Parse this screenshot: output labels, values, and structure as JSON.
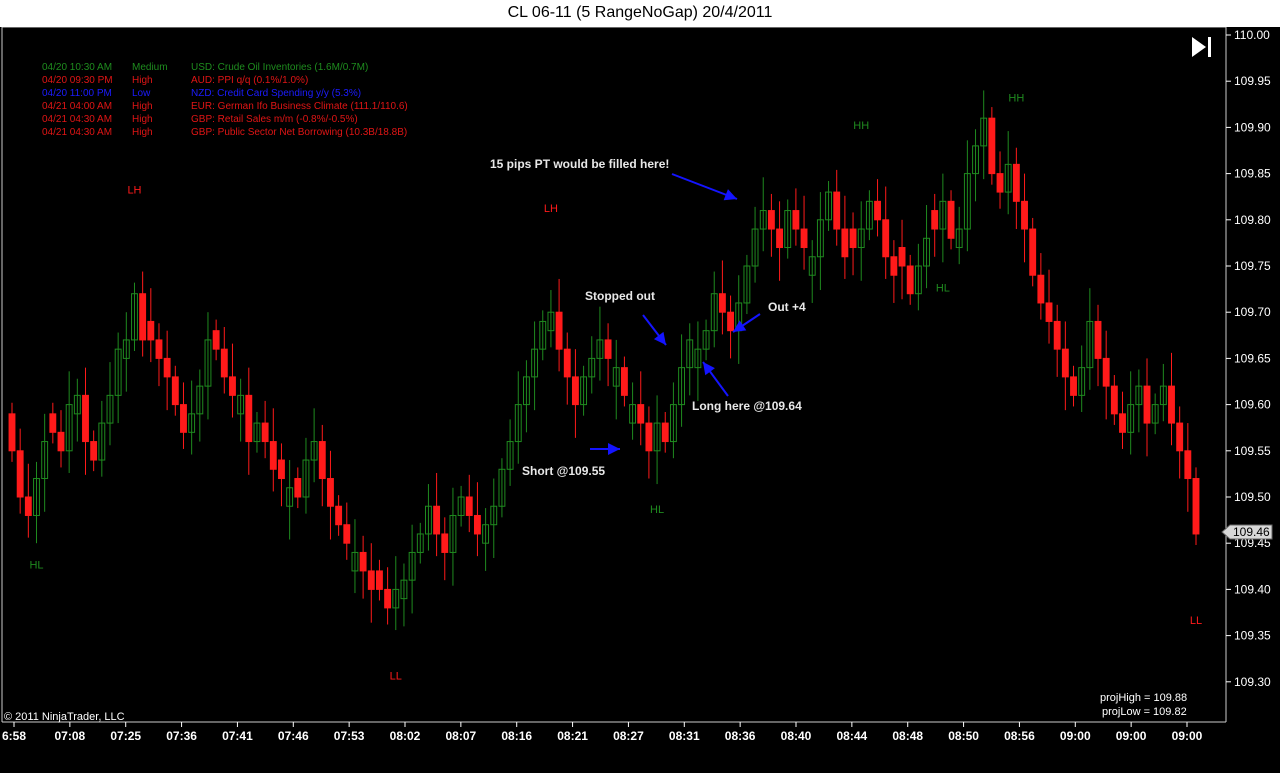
{
  "window": {
    "title": "CL 06-11 (5 RangeNoGap)  20/4/2011"
  },
  "toolbar": {
    "play_icon": "skip-to-end-icon"
  },
  "news": [
    {
      "time": "04/20 10:30 AM",
      "impact": "Medium",
      "event": "USD: Crude Oil Inventories (1.6M/0.7M)",
      "color": "#1e8c1e"
    },
    {
      "time": "04/20 09:30 PM",
      "impact": "High",
      "event": "AUD: PPI q/q (0.1%/1.0%)",
      "color": "#e01515"
    },
    {
      "time": "04/20 11:00 PM",
      "impact": "Low",
      "event": "NZD: Credit Card Spending y/y (5.3%)",
      "color": "#1c1cff"
    },
    {
      "time": "04/21 04:00 AM",
      "impact": "High",
      "event": "EUR: German Ifo Business Climate (111.1/110.6)",
      "color": "#e01515"
    },
    {
      "time": "04/21 04:30 AM",
      "impact": "High",
      "event": "GBP: Retail Sales m/m (-0.8%/-0.5%)",
      "color": "#e01515"
    },
    {
      "time": "04/21 04:30 AM",
      "impact": "High",
      "event": "GBP: Public Sector Net Borrowing (10.3B/18.8B)",
      "color": "#e01515"
    }
  ],
  "chart_data": {
    "type": "candlestick",
    "ylim": [
      109.25,
      110.02
    ],
    "y_ticks": [
      "110.00",
      "109.95",
      "109.90",
      "109.85",
      "109.80",
      "109.75",
      "109.70",
      "109.65",
      "109.60",
      "109.55",
      "109.50",
      "109.45",
      "109.40",
      "109.35",
      "109.30"
    ],
    "x_ticks": [
      "6:58",
      "07:08",
      "07:25",
      "07:36",
      "07:41",
      "07:46",
      "07:53",
      "08:02",
      "08:07",
      "08:16",
      "08:21",
      "08:27",
      "08:31",
      "08:36",
      "08:40",
      "08:44",
      "08:48",
      "08:50",
      "08:56",
      "09:00",
      "09:00",
      "09:00"
    ],
    "bar_closes": [
      109.55,
      109.5,
      109.48,
      109.52,
      109.56,
      109.57,
      109.55,
      109.6,
      109.61,
      109.56,
      109.54,
      109.58,
      109.61,
      109.66,
      109.67,
      109.72,
      109.67,
      109.67,
      109.65,
      109.63,
      109.6,
      109.57,
      109.59,
      109.62,
      109.67,
      109.66,
      109.63,
      109.61,
      109.61,
      109.56,
      109.58,
      109.56,
      109.53,
      109.52,
      109.51,
      109.5,
      109.54,
      109.56,
      109.52,
      109.49,
      109.47,
      109.45,
      109.44,
      109.42,
      109.4,
      109.4,
      109.38,
      109.4,
      109.41,
      109.44,
      109.46,
      109.49,
      109.46,
      109.44,
      109.48,
      109.5,
      109.48,
      109.46,
      109.47,
      109.49,
      109.53,
      109.56,
      109.6,
      109.63,
      109.66,
      109.69,
      109.7,
      109.66,
      109.63,
      109.6,
      109.63,
      109.65,
      109.67,
      109.65,
      109.64,
      109.61,
      109.6,
      109.58,
      109.55,
      109.58,
      109.56,
      109.6,
      109.64,
      109.67,
      109.66,
      109.68,
      109.72,
      109.7,
      109.68,
      109.71,
      109.75,
      109.79,
      109.81,
      109.79,
      109.77,
      109.81,
      109.79,
      109.77,
      109.76,
      109.8,
      109.83,
      109.79,
      109.76,
      109.77,
      109.79,
      109.82,
      109.8,
      109.76,
      109.74,
      109.75,
      109.72,
      109.75,
      109.78,
      109.79,
      109.82,
      109.78,
      109.79,
      109.85,
      109.88,
      109.91,
      109.85,
      109.83,
      109.86,
      109.82,
      109.79,
      109.74,
      109.71,
      109.69,
      109.66,
      109.63,
      109.61,
      109.64,
      109.69,
      109.65,
      109.62,
      109.59,
      109.57,
      109.6,
      109.62,
      109.58,
      109.6,
      109.62,
      109.58,
      109.55,
      109.52,
      109.46
    ],
    "last_price": "109.46",
    "swing_labels": [
      {
        "text": "LH",
        "type": "high",
        "bar_index": 15
      },
      {
        "text": "HL",
        "type": "low",
        "bar_index": 3
      },
      {
        "text": "LL",
        "type": "low",
        "bar_index": 47
      },
      {
        "text": "LH",
        "type": "high",
        "bar_index": 66
      },
      {
        "text": "HL",
        "type": "low",
        "bar_index": 79
      },
      {
        "text": "HH",
        "type": "high",
        "bar_index": 104
      },
      {
        "text": "HL",
        "type": "low",
        "bar_index": 114
      },
      {
        "text": "HH",
        "type": "high",
        "bar_index": 123
      },
      {
        "text": "LL",
        "type": "low",
        "bar_index": 147
      }
    ],
    "annotations": [
      {
        "text": "15 pips PT would be filled here!",
        "price": 109.84
      },
      {
        "text": "Stopped out",
        "price": 109.66
      },
      {
        "text": "Out +4",
        "price": 109.67
      },
      {
        "text": "Long here @109.64",
        "price": 109.64
      },
      {
        "text": "Short @109.55",
        "price": 109.55
      }
    ],
    "proj_high": "projHigh = 109.88",
    "proj_low": "projLow = 109.82",
    "up_color": "#1f8a1f",
    "down_color": "#ff1a1a",
    "axis_color": "#ffffff",
    "annotation_color": "#1414ff"
  },
  "footer": {
    "copyright": "© 2011 NinjaTrader, LLC"
  }
}
